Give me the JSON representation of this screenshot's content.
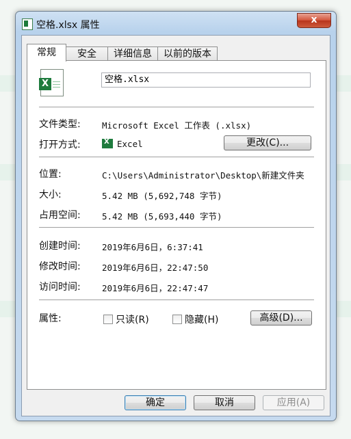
{
  "window": {
    "title": "空格.xlsx 属性",
    "close_label": "x"
  },
  "tabs": [
    {
      "label": "常规"
    },
    {
      "label": "安全"
    },
    {
      "label": "详细信息"
    },
    {
      "label": "以前的版本"
    }
  ],
  "general": {
    "file_name": "空格.xlsx",
    "file_type_label": "文件类型:",
    "file_type_value": "Microsoft Excel 工作表 (.xlsx)",
    "open_with_label": "打开方式:",
    "open_with_value": "Excel",
    "change_button": "更改(C)...",
    "location_label": "位置:",
    "location_value": "C:\\Users\\Administrator\\Desktop\\新建文件夹",
    "size_label": "大小:",
    "size_value": "5.42 MB (5,692,748 字节)",
    "disk_size_label": "占用空间:",
    "disk_size_value": "5.42 MB (5,693,440 字节)",
    "created_label": "创建时间:",
    "created_value": "2019年6月6日，6:37:41",
    "modified_label": "修改时间:",
    "modified_value": "2019年6月6日，22:47:50",
    "accessed_label": "访问时间:",
    "accessed_value": "2019年6月6日，22:47:47",
    "attributes_label": "属性:",
    "readonly_label": "只读(R)",
    "hidden_label": "隐藏(H)",
    "advanced_button": "高级(D)..."
  },
  "footer": {
    "ok_button": "确定",
    "cancel_button": "取消",
    "apply_button": "应用(A)"
  },
  "colors": {
    "excel_green": "#1e7b3d",
    "window_frame": "#b8d2ec",
    "close_red": "#c9452b"
  }
}
